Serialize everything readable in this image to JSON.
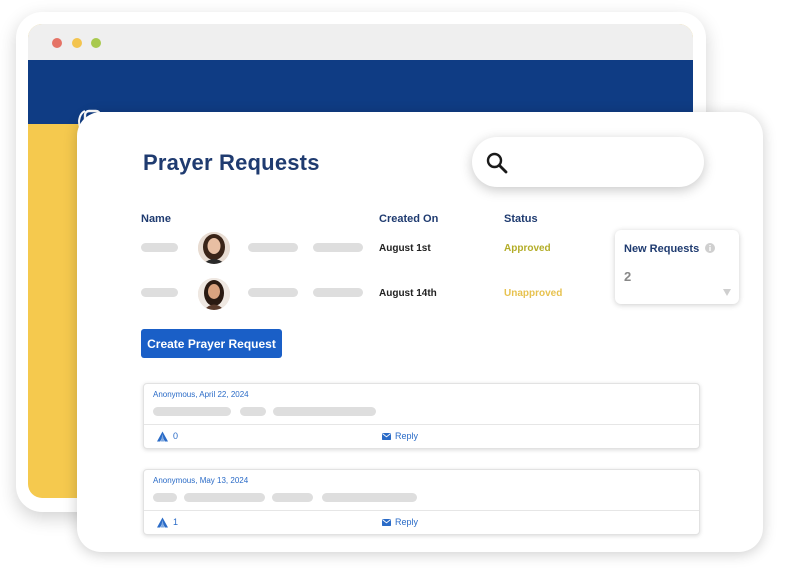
{
  "browser": {
    "colors": {
      "nav": "#0f3c84",
      "accent_panel": "#f5c94e",
      "titlebar": "#efefef"
    },
    "logo_icon": "church-logo-icon",
    "dots": [
      "#e57366",
      "#f3c44f",
      "#a8c94e"
    ]
  },
  "page": {
    "title": "Prayer Requests"
  },
  "search": {
    "icon": "search-icon",
    "placeholder": ""
  },
  "table": {
    "headers": {
      "name": "Name",
      "created_on": "Created On",
      "status": "Status"
    },
    "rows": [
      {
        "created_on": "August 1st",
        "status": "Approved",
        "status_color": "#b3ad28"
      },
      {
        "created_on": "August 14th",
        "status": "Unapproved",
        "status_color": "#e7c24f"
      }
    ]
  },
  "new_requests": {
    "label": "New Requests",
    "count": "2",
    "info_icon": "info-icon"
  },
  "create_button": {
    "label": "Create Prayer Request"
  },
  "posts": [
    {
      "meta": "Anonymous, April 22, 2024",
      "pray_count": "0",
      "reply_label": "Reply"
    },
    {
      "meta": "Anonymous, May 13, 2024",
      "pray_count": "1",
      "reply_label": "Reply"
    }
  ]
}
